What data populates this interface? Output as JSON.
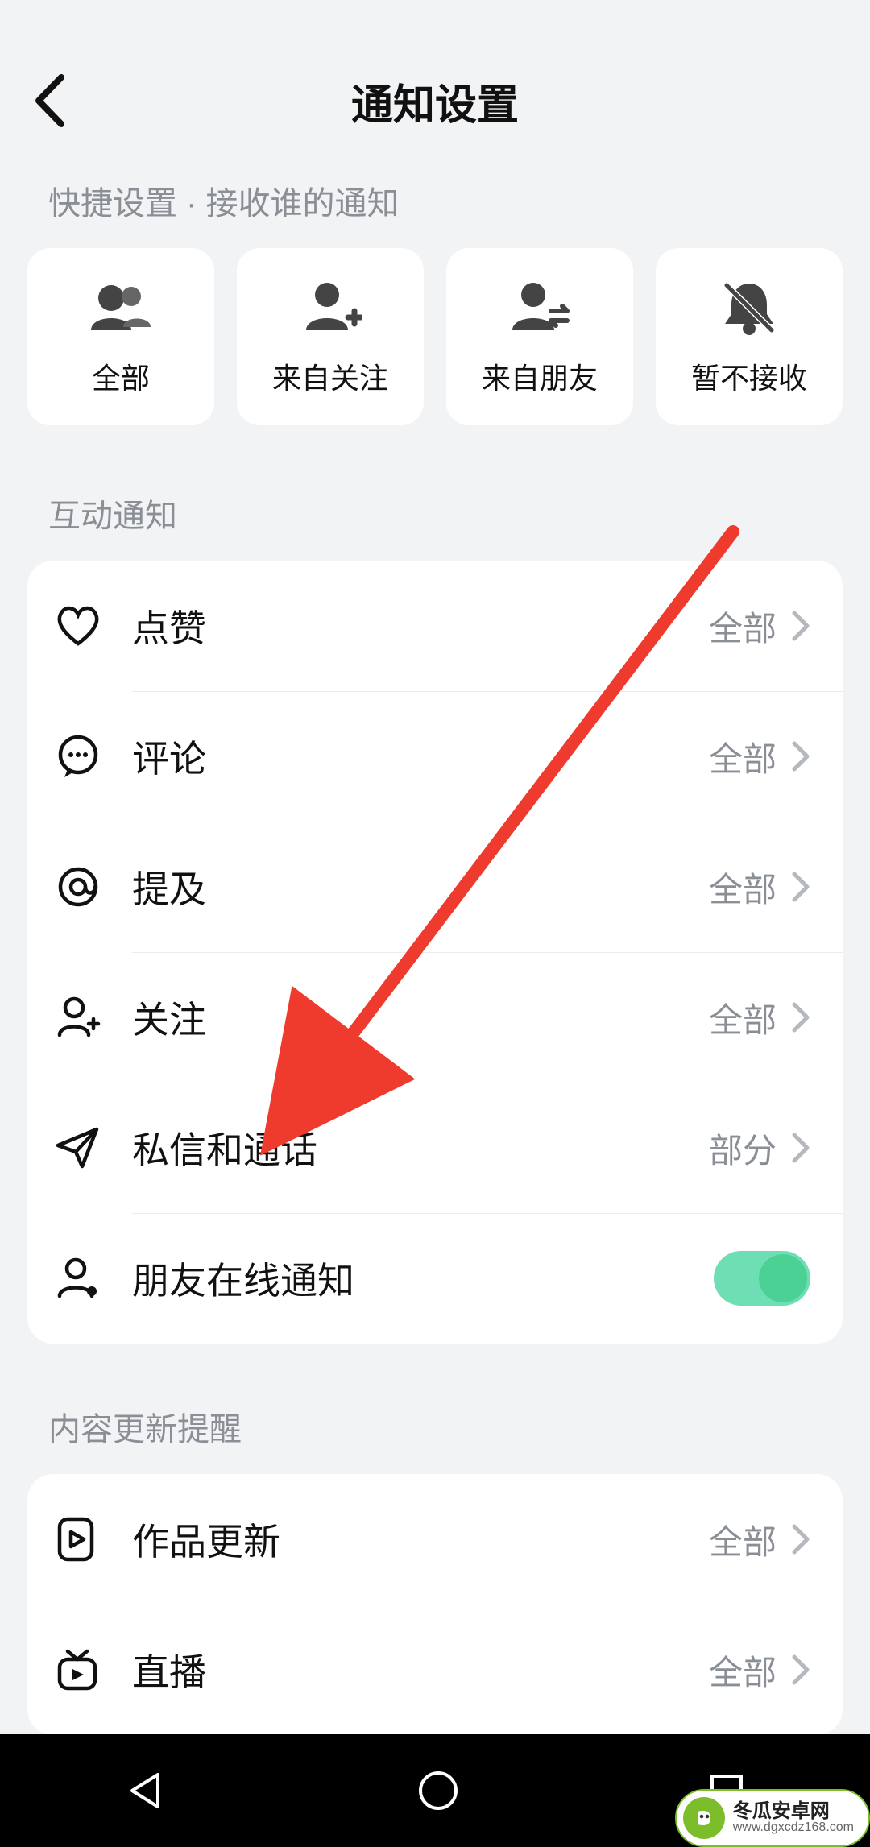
{
  "header": {
    "title": "通知设置"
  },
  "quick": {
    "section_label": "快捷设置 · 接收谁的通知",
    "cards": [
      {
        "label": "全部"
      },
      {
        "label": "来自关注"
      },
      {
        "label": "来自朋友"
      },
      {
        "label": "暂不接收"
      }
    ]
  },
  "interaction": {
    "section_label": "互动通知",
    "items": [
      {
        "label": "点赞",
        "value": "全部"
      },
      {
        "label": "评论",
        "value": "全部"
      },
      {
        "label": "提及",
        "value": "全部"
      },
      {
        "label": "关注",
        "value": "全部"
      },
      {
        "label": "私信和通话",
        "value": "部分"
      },
      {
        "label": "朋友在线通知",
        "toggle": true
      }
    ]
  },
  "content_update": {
    "section_label": "内容更新提醒",
    "items": [
      {
        "label": "作品更新",
        "value": "全部"
      },
      {
        "label": "直播",
        "value": "全部"
      }
    ]
  },
  "watermark": {
    "line1": "冬瓜安卓网",
    "line2": "www.dgxcdz168.com"
  }
}
